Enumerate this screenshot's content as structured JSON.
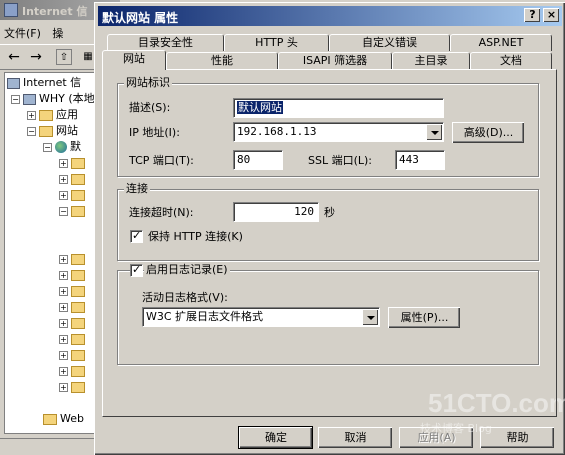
{
  "background": {
    "title": "Internet 信",
    "menu": [
      "文件(F)",
      "操"
    ],
    "tree": [
      {
        "label": "Internet 信",
        "icon": "computer-icon",
        "expander": ""
      },
      {
        "label": "WHY (本地",
        "icon": "computer-icon",
        "expander": "−"
      },
      {
        "label": "应用",
        "icon": "folder-icon",
        "expander": "+"
      },
      {
        "label": "网站",
        "icon": "folder-icon",
        "expander": "−"
      },
      {
        "label": "默",
        "icon": "globe-icon",
        "expander": "−"
      },
      {
        "label": "Web",
        "icon": "folder-icon",
        "expander": ""
      }
    ]
  },
  "dialog": {
    "title": "默认网站 属性",
    "help_button": "?",
    "close_button": "×",
    "tabs_back": [
      "目录安全性",
      "HTTP 头",
      "自定义错误",
      "ASP.NET"
    ],
    "tabs_front": [
      "网站",
      "性能",
      "ISAPI 筛选器",
      "主目录",
      "文档"
    ],
    "identity": {
      "group_title": "网站标识",
      "description_label": "描述(S):",
      "description_value": "默认网站",
      "ip_label": "IP 地址(I):",
      "ip_value": "192.168.1.13",
      "advanced_button": "高级(D)...",
      "tcp_label": "TCP 端口(T):",
      "tcp_value": "80",
      "ssl_label": "SSL 端口(L):",
      "ssl_value": "443"
    },
    "connections": {
      "group_title": "连接",
      "timeout_label": "连接超时(N):",
      "timeout_value": "120",
      "timeout_unit": "秒",
      "keepalive_label": "保持 HTTP 连接(K)",
      "keepalive_checked": true
    },
    "logging": {
      "enable_label": "启用日志记录(E)",
      "enable_checked": true,
      "format_label": "活动日志格式(V):",
      "format_value": "W3C 扩展日志文件格式",
      "properties_button": "属性(P)..."
    },
    "buttons": {
      "ok": "确定",
      "cancel": "取消",
      "apply": "应用(A)",
      "help": "帮助"
    }
  },
  "watermark": {
    "main": "51CTO.com",
    "sub": "技术博客  Blog"
  },
  "colors": {
    "titlebar_active_start": "#0a246a",
    "titlebar_active_end": "#a6caf0",
    "face": "#d4d0c8",
    "selection": "#0a246a"
  }
}
